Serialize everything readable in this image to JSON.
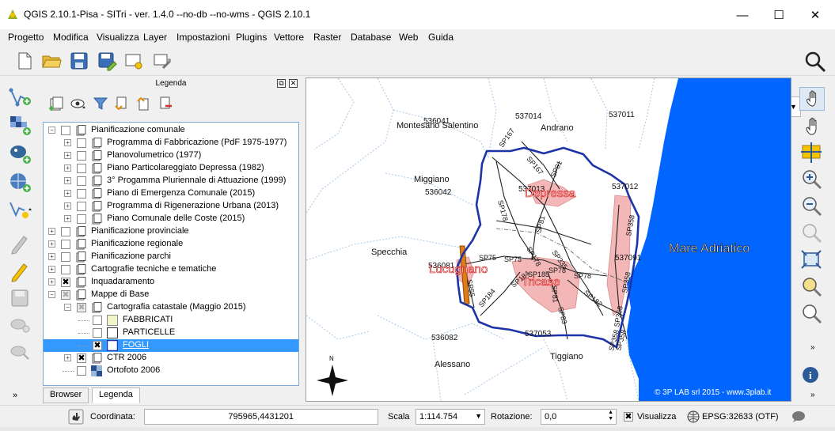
{
  "window": {
    "title": "QGIS 2.10.1-Pisa - SITri - ver. 1.4.0 --no-db --no-wms - QGIS 2.10.1",
    "minimize": "—",
    "maximize": "☐",
    "close": "✕"
  },
  "menu": [
    "Progetto",
    "Modifica",
    "Visualizza",
    "Layer",
    "Impostazioni",
    "Plugins",
    "Vettore",
    "Raster",
    "Database",
    "Web",
    "Guida"
  ],
  "search": {
    "value": "",
    "placeholder": ""
  },
  "legend": {
    "title": "Legenda",
    "float_btn": "⧉",
    "close_btn": "✕",
    "items": [
      {
        "label": "Pianificazione comunale",
        "level": 0,
        "expand": "−",
        "checked": false
      },
      {
        "label": "Programma di Fabbricazione (PdF 1975-1977)",
        "level": 1,
        "expand": "+",
        "checked": false
      },
      {
        "label": "Planovolumetrico (1977)",
        "level": 1,
        "expand": "+",
        "checked": false
      },
      {
        "label": "Piano Particolareggiato Depressa (1982)",
        "level": 1,
        "expand": "+",
        "checked": false
      },
      {
        "label": "3° Progamma Pluriennale di Attuazione (1999)",
        "level": 1,
        "expand": "+",
        "checked": false
      },
      {
        "label": "Piano di Emergenza Comunale (2015)",
        "level": 1,
        "expand": "+",
        "checked": false
      },
      {
        "label": "Programma di Rigenerazione Urbana (2013)",
        "level": 1,
        "expand": "+",
        "checked": false
      },
      {
        "label": "Piano Comunale delle Coste (2015)",
        "level": 1,
        "expand": "+",
        "checked": false
      },
      {
        "label": "Pianificazione provinciale",
        "level": 0,
        "expand": "+",
        "checked": false
      },
      {
        "label": "Pianificazione regionale",
        "level": 0,
        "expand": "+",
        "checked": false
      },
      {
        "label": "Pianificazione parchi",
        "level": 0,
        "expand": "+",
        "checked": false
      },
      {
        "label": "Cartografie tecniche e tematiche",
        "level": 0,
        "expand": "+",
        "checked": false
      },
      {
        "label": "Inquadaramento",
        "level": 0,
        "expand": "+",
        "checked": true
      },
      {
        "label": "Mappe di Base",
        "level": 0,
        "expand": "−",
        "checked": "partial"
      },
      {
        "label": "Cartografia catastale (Maggio 2015)",
        "level": 1,
        "expand": "−",
        "checked": "partial"
      },
      {
        "label": "FABBRICATI",
        "level": 2,
        "expand": "",
        "checked": false,
        "symbol": "fill-yellow"
      },
      {
        "label": "PARTICELLE",
        "level": 2,
        "expand": "",
        "checked": false,
        "symbol": "fill-white"
      },
      {
        "label": "FOGLI",
        "level": 2,
        "expand": "",
        "checked": true,
        "symbol": "line-blue",
        "selected": true
      },
      {
        "label": "CTR 2006",
        "level": 1,
        "expand": "+",
        "checked": true
      },
      {
        "label": "Ortofoto 2006",
        "level": 1,
        "expand": "",
        "checked": false,
        "symbol": "raster"
      }
    ]
  },
  "tabs": [
    {
      "label": "Browser"
    },
    {
      "label": "Legenda"
    }
  ],
  "map": {
    "sea_label": "Mare  Adriatico",
    "copyright": "© 3P LAB srl 2015 - www.3plab.it",
    "north": "N",
    "places": [
      {
        "text": "Montesano Salentino"
      },
      {
        "text": "536041"
      },
      {
        "text": "537014"
      },
      {
        "text": "Andrano"
      },
      {
        "text": "537011"
      },
      {
        "text": "Miggiano"
      },
      {
        "text": "536042"
      },
      {
        "text": "537012"
      },
      {
        "text": "Specchia"
      },
      {
        "text": "536081"
      },
      {
        "text": "537091"
      },
      {
        "text": "536082"
      },
      {
        "text": "537053"
      },
      {
        "text": "Alessano"
      },
      {
        "text": "Tiggiano"
      },
      {
        "text": "537013"
      }
    ],
    "town_labels": [
      "Depressa",
      "Lucugnano",
      "Tricase"
    ],
    "roads": [
      "SP167",
      "SP167",
      "SP81",
      "SP178",
      "SP81",
      "SP178",
      "SP335",
      "SP75",
      "SP75",
      "SP184",
      "SP185",
      "SP78",
      "SP78",
      "SP81",
      "SP182",
      "SP358",
      "SP358",
      "SP358",
      "SP184",
      "SP83",
      "SP358",
      "SP55",
      "SP358"
    ]
  },
  "status": {
    "coord_label": "Coordinata:",
    "coord_value": "795965,4431201",
    "scale_label": "Scala",
    "scale_value": "1:114.754",
    "rot_label": "Rotazione:",
    "rot_value": "0,0",
    "render_label": "Visualizza",
    "crs": "EPSG:32633 (OTF)"
  },
  "colors": {
    "sea": "#0066ff",
    "boundary": "#1d33a8",
    "town": "#f4b7b7",
    "road": "#333333",
    "selection": "#3399ff"
  }
}
